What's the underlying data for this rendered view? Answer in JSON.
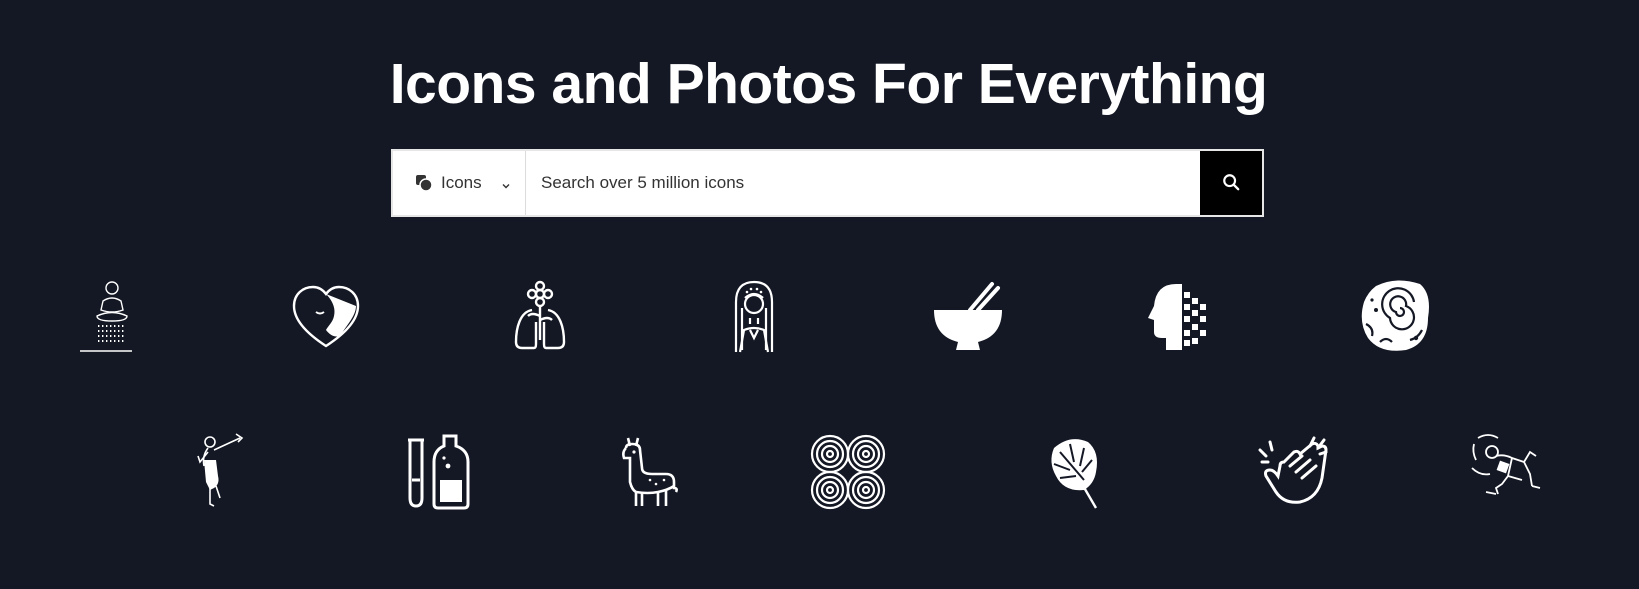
{
  "hero": {
    "title": "Icons and Photos For Everything"
  },
  "search": {
    "type_label": "Icons",
    "placeholder": "Search over 5 million icons",
    "value": ""
  },
  "colors": {
    "background": "#141824",
    "text": "#ffffff",
    "search_button": "#000000"
  },
  "icons": [
    "meditation-shower-icon",
    "heart-face-icon",
    "lungs-flower-icon",
    "woman-portrait-icon",
    "bowl-chopsticks-icon",
    "pixel-head-icon",
    "ammonite-fossil-icon",
    "dancer-icon",
    "test-tube-bottle-icon",
    "llama-icon",
    "spiral-pattern-icon",
    "monstera-leaf-icon",
    "clapping-hands-icon",
    "breakdancer-icon"
  ]
}
